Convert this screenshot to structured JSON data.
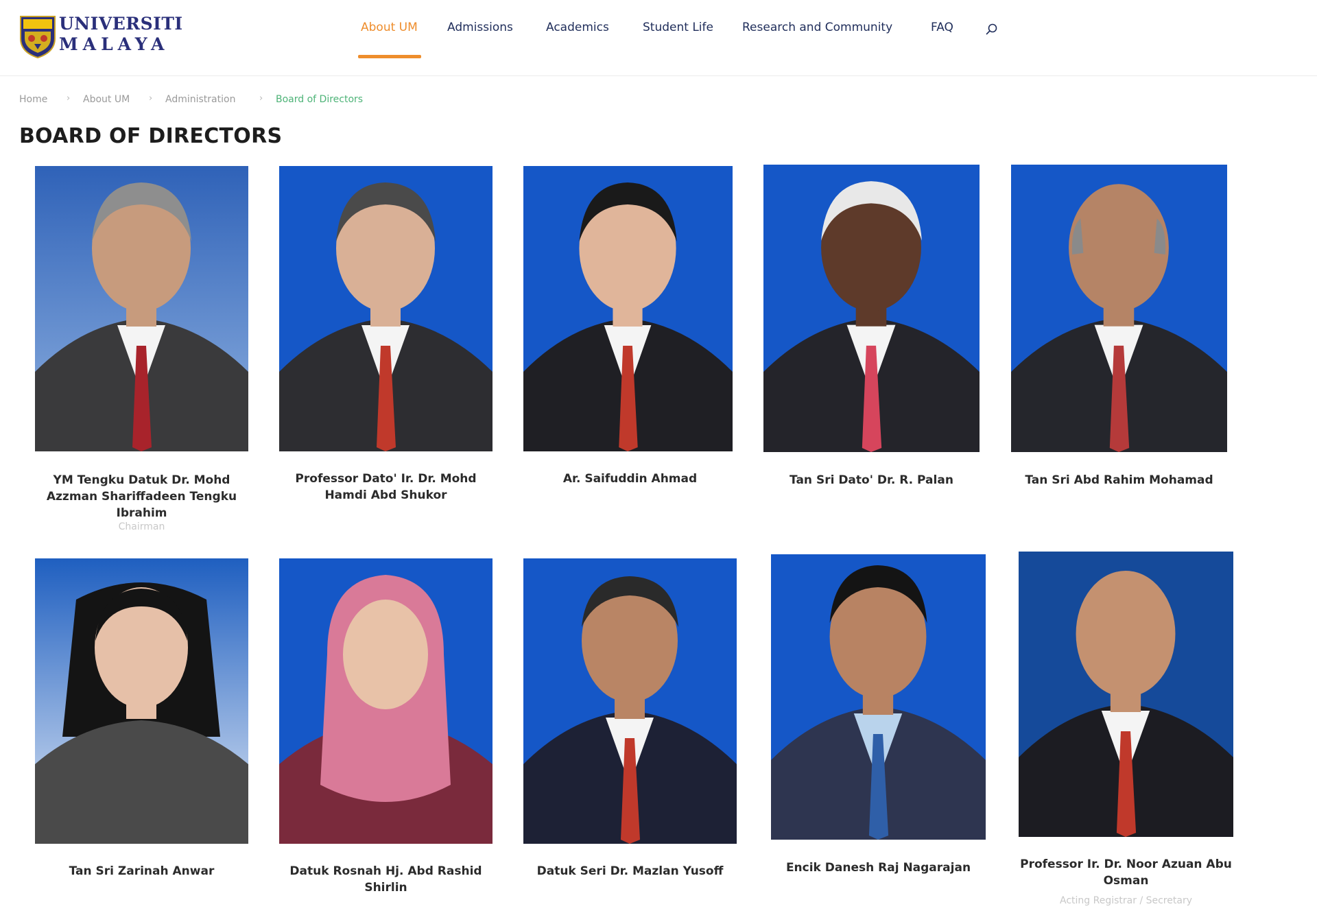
{
  "header": {
    "logo": {
      "line1": "UNIVERSITI",
      "line2": "MALAYA"
    },
    "nav": [
      {
        "label": "About UM"
      },
      {
        "label": "Admissions"
      },
      {
        "label": "Academics"
      },
      {
        "label": "Student Life"
      },
      {
        "label": "Research and Community"
      },
      {
        "label": "FAQ"
      }
    ],
    "active_nav": "About UM",
    "search_icon": "search-icon",
    "accent_color": "#ee8d2c"
  },
  "breadcrumb": [
    {
      "label": "Home"
    },
    {
      "label": "About UM"
    },
    {
      "label": "Administration"
    },
    {
      "label": "Board of Directors"
    }
  ],
  "page": {
    "title": "BOARD OF DIRECTORS"
  },
  "members": [
    {
      "name": "YM Tengku Datuk Dr. Mohd Azzman Shariffadeen Tengku Ibrahim",
      "role": "Chairman"
    },
    {
      "name": "Professor Dato' Ir. Dr. Mohd Hamdi Abd Shukor",
      "role": ""
    },
    {
      "name": "Ar. Saifuddin Ahmad",
      "role": ""
    },
    {
      "name": "Tan Sri Dato' Dr. R. Palan",
      "role": ""
    },
    {
      "name": "Tan Sri Abd Rahim Mohamad",
      "role": ""
    },
    {
      "name": "Tan Sri Zarinah Anwar",
      "role": ""
    },
    {
      "name": "Datuk Rosnah Hj. Abd Rashid Shirlin",
      "role": ""
    },
    {
      "name": "Datuk Seri Dr. Mazlan Yusoff",
      "role": ""
    },
    {
      "name": "Encik Danesh Raj Nagarajan",
      "role": ""
    },
    {
      "name": "Professor Ir. Dr. Noor Azuan Abu Osman",
      "role": "Acting Registrar / Secretary"
    }
  ]
}
